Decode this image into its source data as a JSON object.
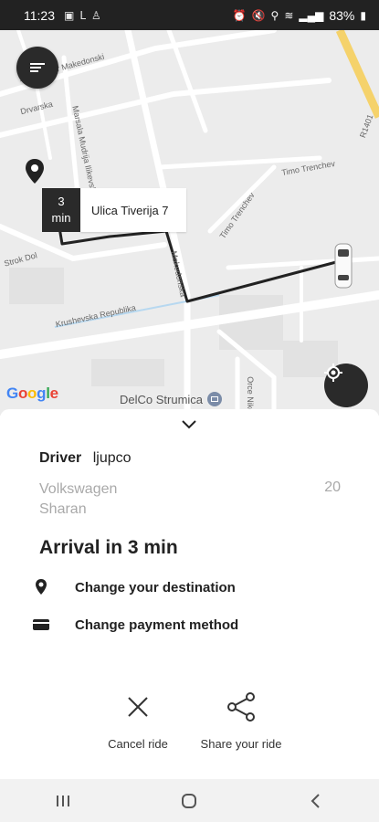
{
  "status_bar": {
    "time": "11:23",
    "battery": "83%"
  },
  "map": {
    "eta_value": "3",
    "eta_unit": "min",
    "destination_label": "Ulica Tiverija 7",
    "poi_label": "DelCo Strumica",
    "google_logo": [
      "G",
      "o",
      "o",
      "g",
      "l",
      "e"
    ],
    "streets": {
      "s1": "Aleksandar Makedonski",
      "s2": "Drvarska",
      "s3": "Marsala Mudrija Ilikevski P",
      "s4": "Timo Trenchev",
      "s5": "Timo Trenchev",
      "s6": "Strok Dol",
      "s7": "Krushevska Republika",
      "s8": "Makedonska",
      "s9": "R1401",
      "s10": "Orce Nikolov"
    }
  },
  "sheet": {
    "driver_key": "Driver",
    "driver_name": "ljupco",
    "car_model": "Volkswagen Sharan",
    "car_number": "20",
    "arrival_text": "Arrival in 3 min",
    "change_destination": "Change your destination",
    "change_payment": "Change payment method",
    "cancel_label": "Cancel ride",
    "share_label": "Share your ride"
  },
  "colors": {
    "dark": "#2a2a2a",
    "route": "#222222",
    "map_bg": "#ececec",
    "highway": "#f5d26b"
  }
}
